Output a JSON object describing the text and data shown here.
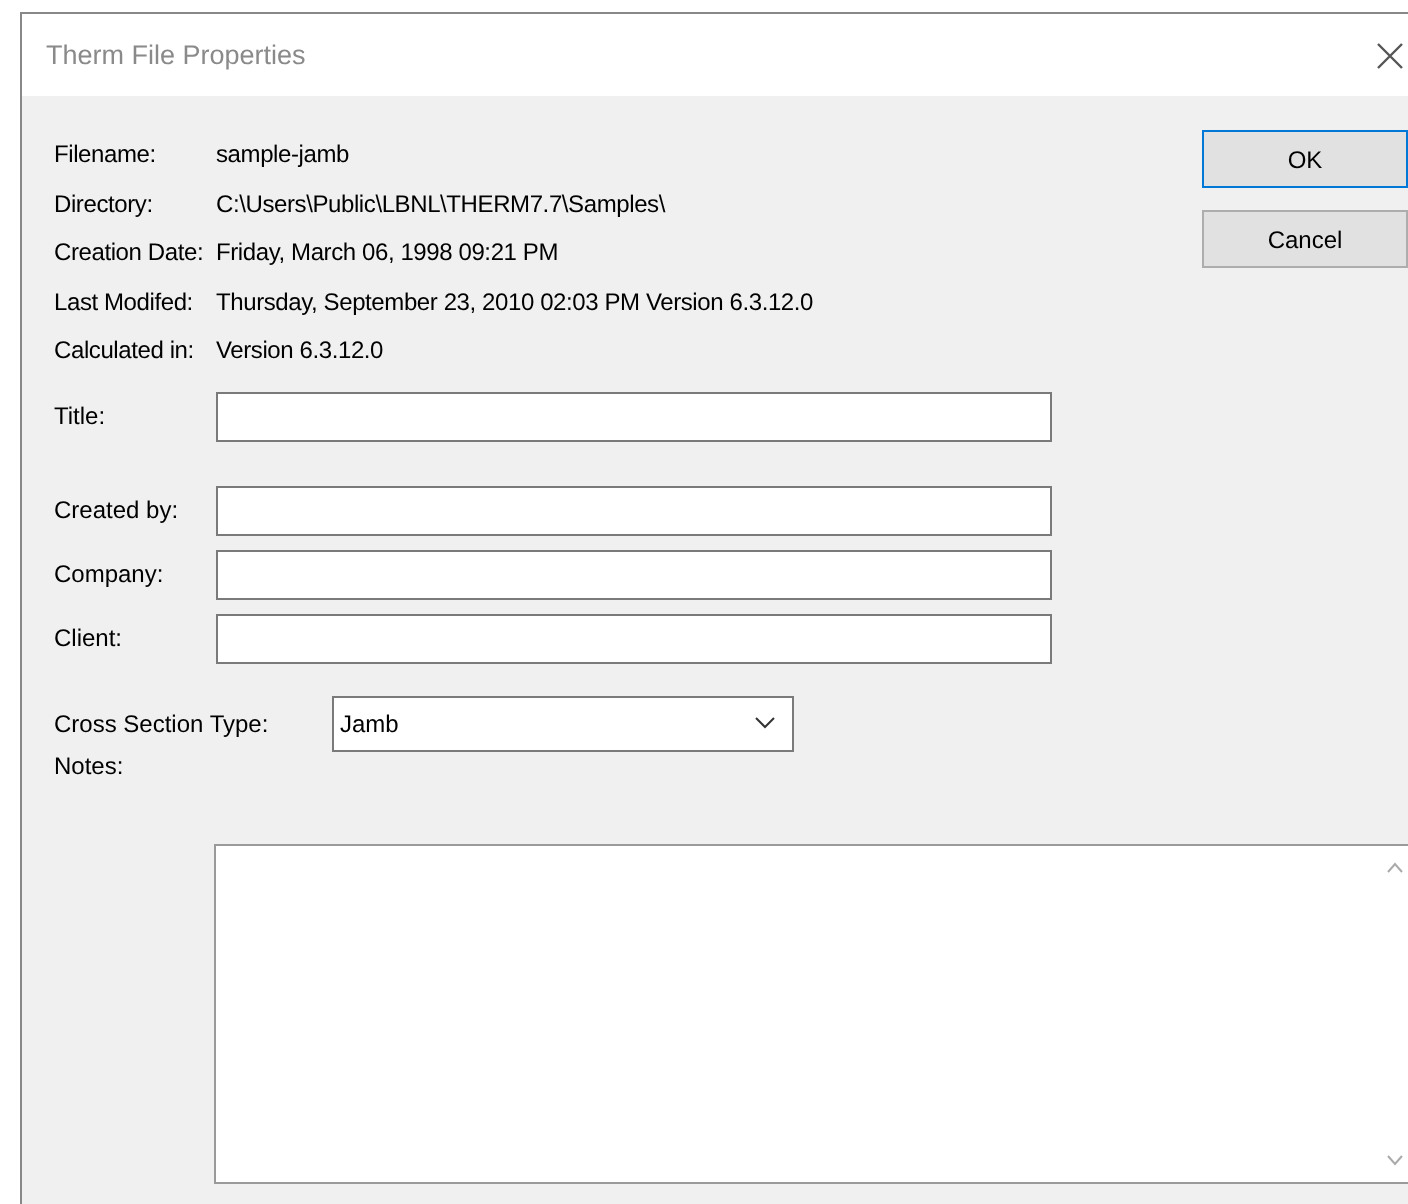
{
  "window": {
    "title": "Therm File Properties"
  },
  "info": [
    {
      "label": "Filename:",
      "value": "sample-jamb"
    },
    {
      "label": "Directory:",
      "value": "C:\\Users\\Public\\LBNL\\THERM7.7\\Samples\\"
    },
    {
      "label": "Creation Date:",
      "value": "Friday, March 06, 1998 09:21 PM"
    },
    {
      "label": "Last Modifed:",
      "value": "Thursday, September 23, 2010 02:03 PM Version 6.3.12.0"
    },
    {
      "label": "Calculated in:",
      "value": "Version 6.3.12.0"
    }
  ],
  "buttons": [
    "OK",
    "Cancel"
  ],
  "title_field": {
    "label": "Title:"
  },
  "fields": [
    {
      "label": "Created by:"
    },
    {
      "label": "Company:"
    },
    {
      "label": "Client:"
    }
  ],
  "cross_section_type": {
    "label": "Cross Section Type:",
    "value": "Jamb"
  },
  "notes": {
    "label": "Notes:"
  }
}
